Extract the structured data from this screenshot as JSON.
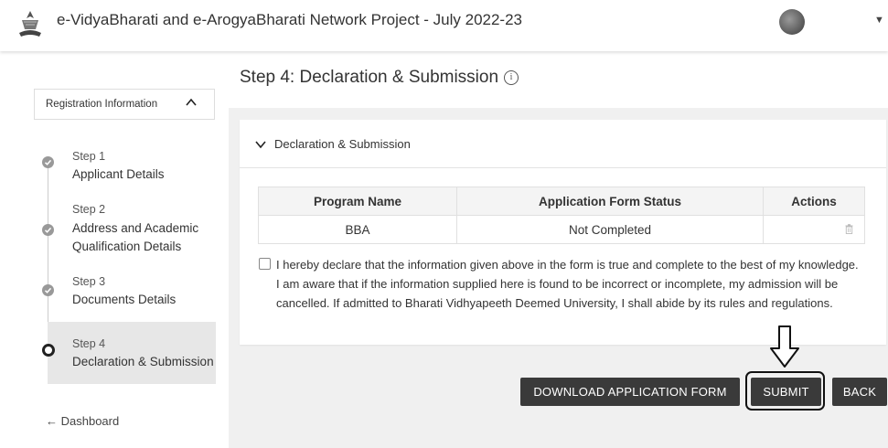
{
  "header": {
    "title": "e-VidyaBharati and e-ArogyaBharati Network Project - July 2022-23"
  },
  "page": {
    "title": "Step 4: Declaration & Submission"
  },
  "sidebar": {
    "registration_toggle": "Registration Information",
    "steps": [
      {
        "number": "Step 1",
        "name": "Applicant Details",
        "status": "completed"
      },
      {
        "number": "Step 2",
        "name": "Address and Academic Qualification Details",
        "status": "completed"
      },
      {
        "number": "Step 3",
        "name": "Documents Details",
        "status": "completed"
      },
      {
        "number": "Step 4",
        "name": "Declaration & Submission",
        "status": "current"
      }
    ],
    "dashboard_link": "Dashboard"
  },
  "section": {
    "title": "Declaration & Submission"
  },
  "table": {
    "headers": [
      "Program Name",
      "Application Form Status",
      "Actions"
    ],
    "rows": [
      {
        "program": "BBA",
        "status": "Not Completed",
        "action_icon": "trash-icon"
      }
    ]
  },
  "declaration": {
    "checked": false,
    "text": "I hereby declare that the information given above in the form is true and complete to the best of my knowledge. I am aware that if the information supplied here is found to be incorrect or incomplete, my admission will be cancelled. If admitted to Bharati Vidhyapeeth Deemed University, I shall abide by its rules and regulations."
  },
  "buttons": {
    "download": "DOWNLOAD APPLICATION FORM",
    "submit": "SUBMIT",
    "back": "BACK"
  },
  "colors": {
    "button_bg": "#3a3a3a",
    "panel_bg": "#f0f0f0",
    "active_step_bg": "#e7e7e7"
  }
}
